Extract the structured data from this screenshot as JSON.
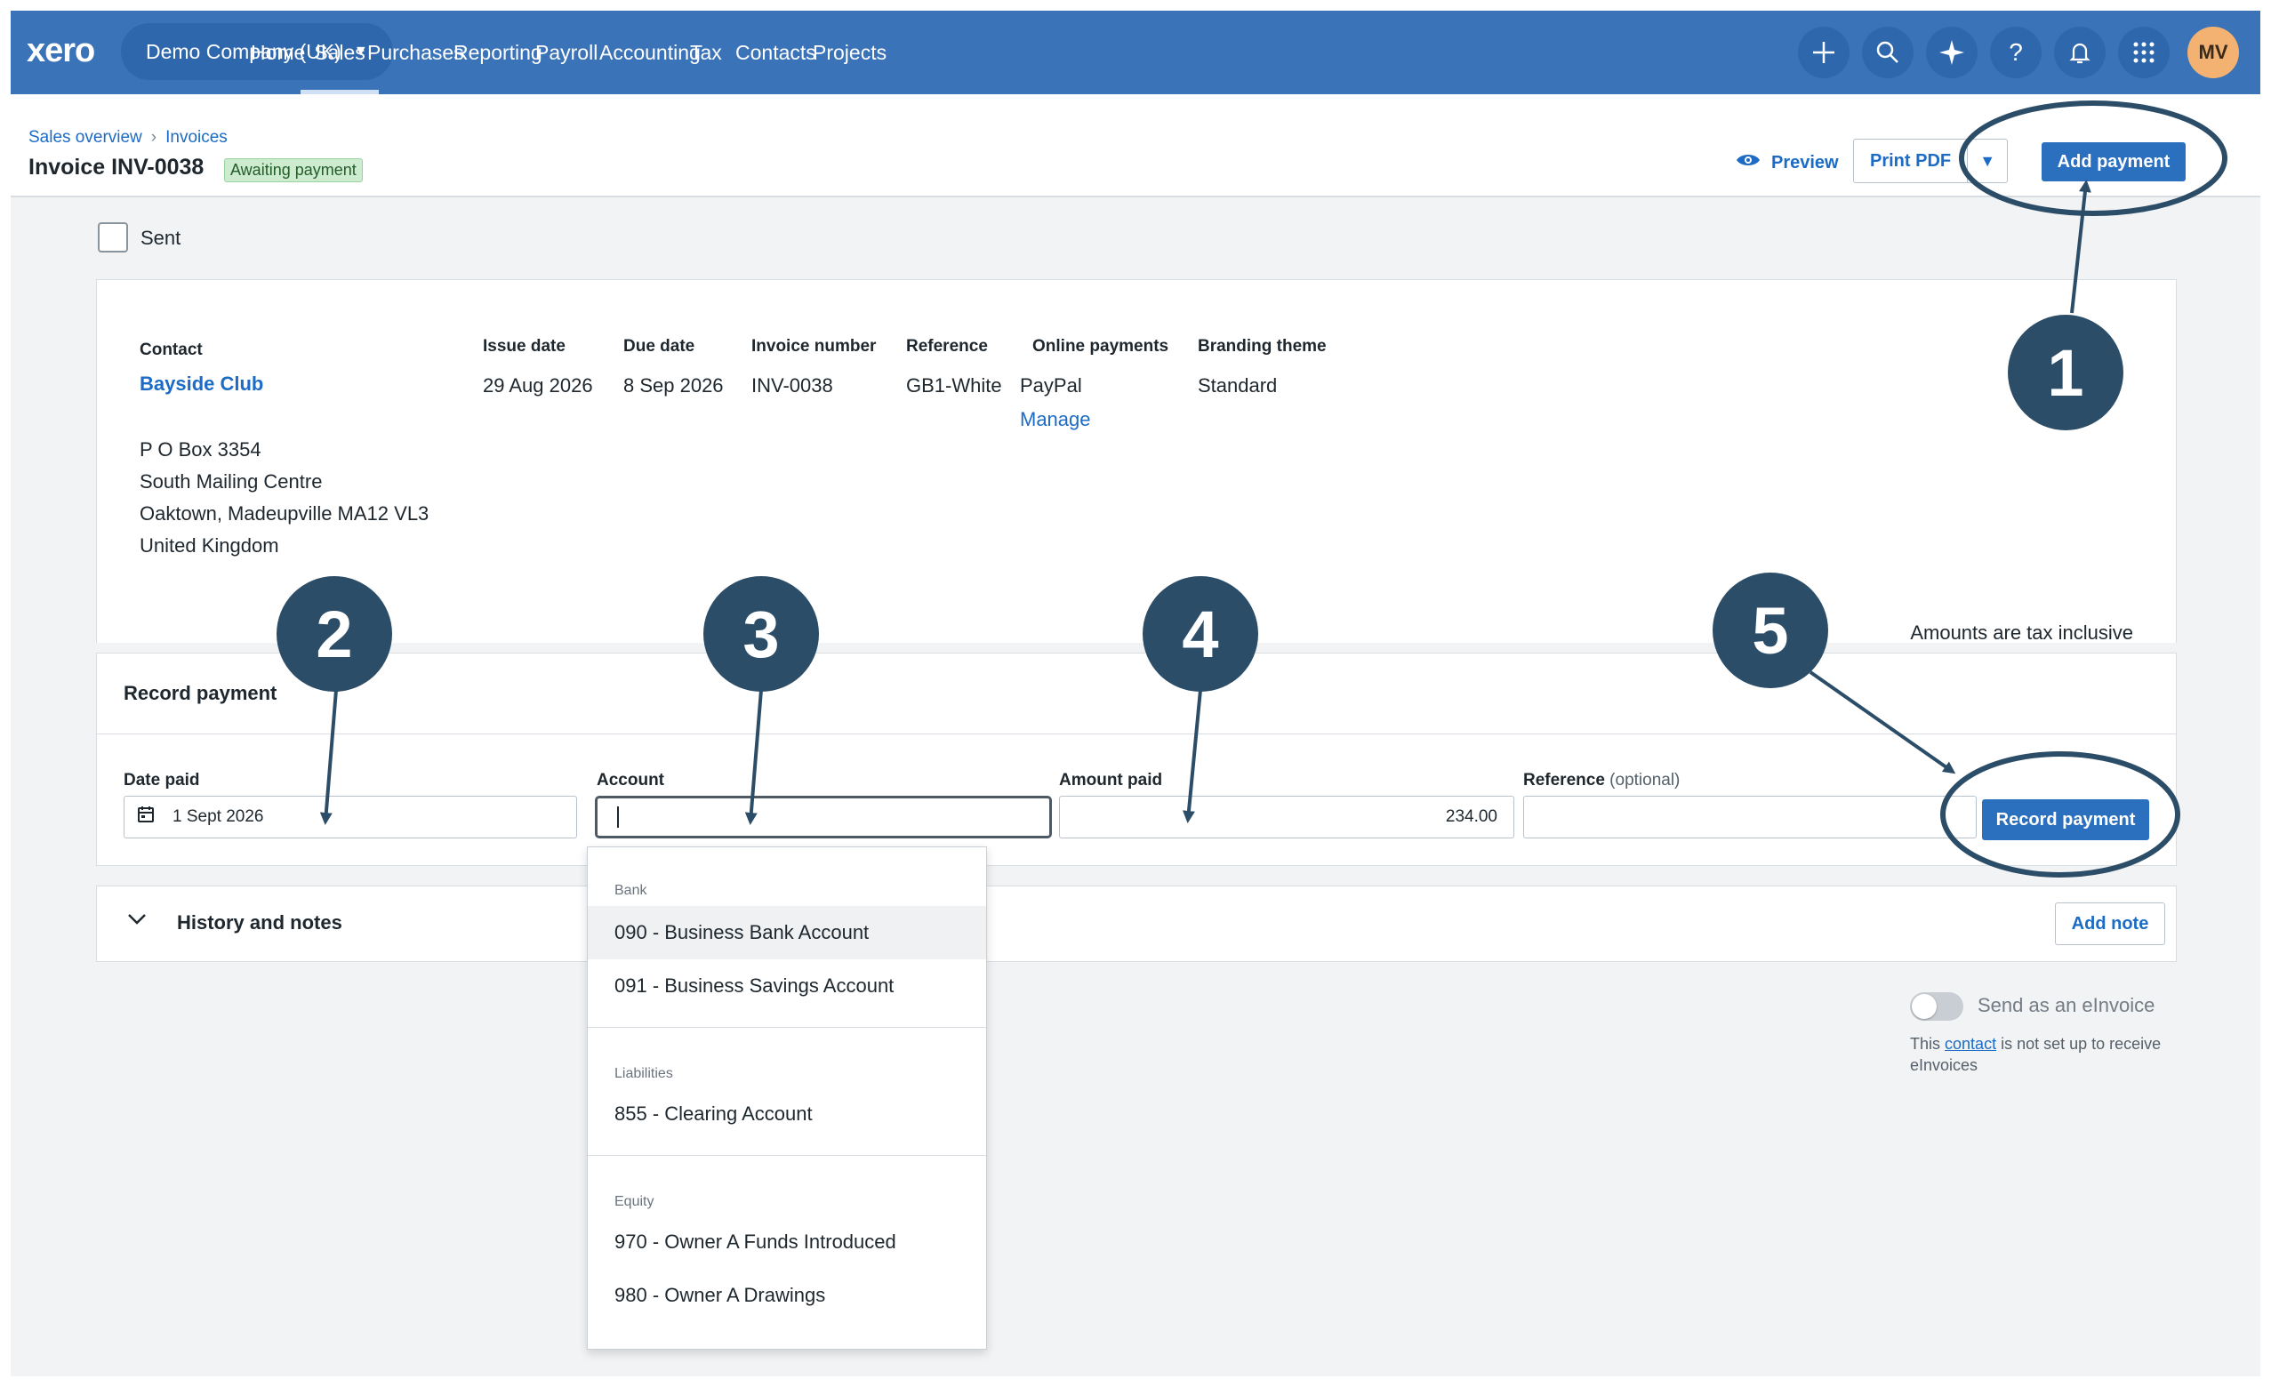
{
  "nav": {
    "logo": "xero",
    "org": "Demo Company (UK)",
    "items": [
      "Home",
      "Sales",
      "Purchases",
      "Reporting",
      "Payroll",
      "Accounting",
      "Tax",
      "Contacts",
      "Projects"
    ],
    "active": "Sales",
    "icons": [
      "plus-icon",
      "search-icon",
      "sparkle-icon",
      "help-icon",
      "bell-icon",
      "apps-grid-icon"
    ],
    "avatar": "MV"
  },
  "header": {
    "breadcrumbs": [
      "Sales overview",
      "Invoices"
    ],
    "title": "Invoice INV-0038",
    "status": "Awaiting payment",
    "preview": "Preview",
    "print_pdf": "Print PDF",
    "add_payment": "Add payment"
  },
  "sent_label": "Sent",
  "invoice": {
    "headers": {
      "contact": "Contact",
      "issue_date": "Issue date",
      "due_date": "Due date",
      "invoice_number": "Invoice number",
      "reference": "Reference",
      "online_payments": "Online payments",
      "branding_theme": "Branding theme"
    },
    "contact_name": "Bayside Club",
    "address": [
      "P O Box 3354",
      "South Mailing Centre",
      "Oaktown, Madeupville MA12 VL3",
      "United Kingdom"
    ],
    "issue_date": "29 Aug 2026",
    "due_date": "8 Sep 2026",
    "invoice_number": "INV-0038",
    "reference": "GB1-White",
    "online_payments": "PayPal",
    "manage": "Manage",
    "branding_theme": "Standard",
    "tax_note": "Amounts are tax inclusive"
  },
  "record_payment": {
    "title": "Record payment",
    "date_label": "Date paid",
    "date_value": "1 Sept 2026",
    "account_label": "Account",
    "account_value": "",
    "amount_label": "Amount paid",
    "amount_value": "234.00",
    "reference_label": "Reference",
    "reference_optional": "(optional)",
    "reference_value": "",
    "button": "Record payment"
  },
  "account_dropdown": {
    "groups": [
      {
        "name": "Bank",
        "items": [
          "090 - Business Bank Account",
          "091 - Business Savings Account"
        ]
      },
      {
        "name": "Liabilities",
        "items": [
          "855 - Clearing Account"
        ]
      },
      {
        "name": "Equity",
        "items": [
          "970 - Owner A Funds Introduced",
          "980 - Owner A Drawings"
        ]
      }
    ],
    "highlighted": "090 - Business Bank Account"
  },
  "history": {
    "title": "History and notes",
    "add_note": "Add note"
  },
  "einvoice": {
    "toggle_label": "Send as an eInvoice",
    "note_pre": "This",
    "note_link": "contact",
    "note_post": "is not set up to receive eInvoices"
  },
  "annotations": [
    "1",
    "2",
    "3",
    "4",
    "5"
  ],
  "colors": {
    "nav_bg": "#3b73b8",
    "primary_button": "#2b6fbf",
    "marker": "#2c4d68",
    "status_badge": "#cdeccf"
  }
}
